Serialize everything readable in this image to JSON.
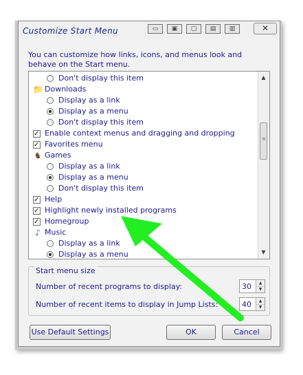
{
  "window": {
    "title": "Customize Start Menu",
    "close_glyph": "✕",
    "toolbar_icons": [
      "window-icon",
      "window-icon",
      "window-icon",
      "window-icon",
      "window-icon"
    ]
  },
  "description": "You can customize how links, icons, and menus look and behave on the Start menu.",
  "list_items": [
    {
      "type": "radio",
      "indent": 1,
      "label": "Don't display this item",
      "checked": false
    },
    {
      "type": "folder",
      "indent": 0,
      "label": "Downloads",
      "icon": "downloads-folder-icon"
    },
    {
      "type": "radio",
      "indent": 1,
      "label": "Display as a link",
      "checked": false
    },
    {
      "type": "radio",
      "indent": 1,
      "label": "Display as a menu",
      "checked": true
    },
    {
      "type": "radio",
      "indent": 1,
      "label": "Don't display this item",
      "checked": false
    },
    {
      "type": "check",
      "indent": 0,
      "label": "Enable context menus and dragging and dropping",
      "checked": true
    },
    {
      "type": "check",
      "indent": 0,
      "label": "Favorites menu",
      "checked": true
    },
    {
      "type": "folder",
      "indent": 0,
      "label": "Games",
      "icon": "games-icon"
    },
    {
      "type": "radio",
      "indent": 1,
      "label": "Display as a link",
      "checked": false
    },
    {
      "type": "radio",
      "indent": 1,
      "label": "Display as a menu",
      "checked": true
    },
    {
      "type": "radio",
      "indent": 1,
      "label": "Don't display this item",
      "checked": false
    },
    {
      "type": "check",
      "indent": 0,
      "label": "Help",
      "checked": true
    },
    {
      "type": "check",
      "indent": 0,
      "label": "Highlight newly installed programs",
      "checked": true
    },
    {
      "type": "check",
      "indent": 0,
      "label": "Homegroup",
      "checked": true
    },
    {
      "type": "folder",
      "indent": 0,
      "label": "Music",
      "icon": "music-note-icon"
    },
    {
      "type": "radio",
      "indent": 1,
      "label": "Display as a link",
      "checked": false
    },
    {
      "type": "radio",
      "indent": 1,
      "label": "Display as a menu",
      "checked": true
    }
  ],
  "start_menu_size": {
    "title": "Start menu size",
    "recent_programs_label": "Number of recent programs to display:",
    "recent_programs_value": "30",
    "recent_items_label": "Number of recent items to display in Jump Lists:",
    "recent_items_value": "40"
  },
  "buttons": {
    "default": "Use Default Settings",
    "ok": "OK",
    "cancel": "Cancel"
  },
  "annotation": {
    "arrow_color": "#22ee22"
  }
}
